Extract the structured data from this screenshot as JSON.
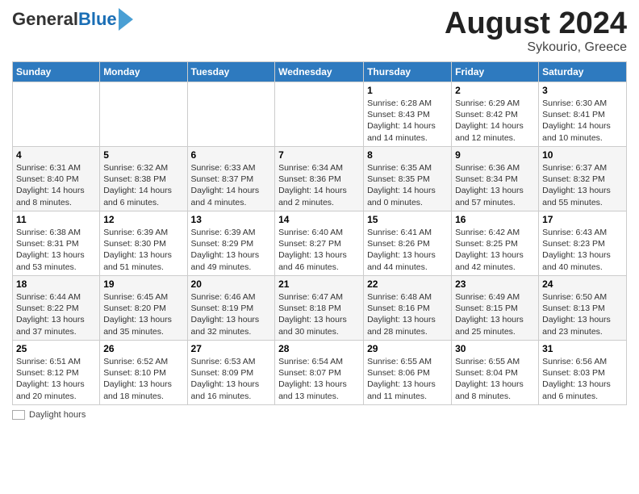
{
  "header": {
    "logo_general": "General",
    "logo_blue": "Blue",
    "month_title": "August 2024",
    "subtitle": "Sykourio, Greece"
  },
  "days_of_week": [
    "Sunday",
    "Monday",
    "Tuesday",
    "Wednesday",
    "Thursday",
    "Friday",
    "Saturday"
  ],
  "legend_label": "Daylight hours",
  "weeks": [
    [
      {
        "day": "",
        "info": ""
      },
      {
        "day": "",
        "info": ""
      },
      {
        "day": "",
        "info": ""
      },
      {
        "day": "",
        "info": ""
      },
      {
        "day": "1",
        "info": "Sunrise: 6:28 AM\nSunset: 8:43 PM\nDaylight: 14 hours and 14 minutes."
      },
      {
        "day": "2",
        "info": "Sunrise: 6:29 AM\nSunset: 8:42 PM\nDaylight: 14 hours and 12 minutes."
      },
      {
        "day": "3",
        "info": "Sunrise: 6:30 AM\nSunset: 8:41 PM\nDaylight: 14 hours and 10 minutes."
      }
    ],
    [
      {
        "day": "4",
        "info": "Sunrise: 6:31 AM\nSunset: 8:40 PM\nDaylight: 14 hours and 8 minutes."
      },
      {
        "day": "5",
        "info": "Sunrise: 6:32 AM\nSunset: 8:38 PM\nDaylight: 14 hours and 6 minutes."
      },
      {
        "day": "6",
        "info": "Sunrise: 6:33 AM\nSunset: 8:37 PM\nDaylight: 14 hours and 4 minutes."
      },
      {
        "day": "7",
        "info": "Sunrise: 6:34 AM\nSunset: 8:36 PM\nDaylight: 14 hours and 2 minutes."
      },
      {
        "day": "8",
        "info": "Sunrise: 6:35 AM\nSunset: 8:35 PM\nDaylight: 14 hours and 0 minutes."
      },
      {
        "day": "9",
        "info": "Sunrise: 6:36 AM\nSunset: 8:34 PM\nDaylight: 13 hours and 57 minutes."
      },
      {
        "day": "10",
        "info": "Sunrise: 6:37 AM\nSunset: 8:32 PM\nDaylight: 13 hours and 55 minutes."
      }
    ],
    [
      {
        "day": "11",
        "info": "Sunrise: 6:38 AM\nSunset: 8:31 PM\nDaylight: 13 hours and 53 minutes."
      },
      {
        "day": "12",
        "info": "Sunrise: 6:39 AM\nSunset: 8:30 PM\nDaylight: 13 hours and 51 minutes."
      },
      {
        "day": "13",
        "info": "Sunrise: 6:39 AM\nSunset: 8:29 PM\nDaylight: 13 hours and 49 minutes."
      },
      {
        "day": "14",
        "info": "Sunrise: 6:40 AM\nSunset: 8:27 PM\nDaylight: 13 hours and 46 minutes."
      },
      {
        "day": "15",
        "info": "Sunrise: 6:41 AM\nSunset: 8:26 PM\nDaylight: 13 hours and 44 minutes."
      },
      {
        "day": "16",
        "info": "Sunrise: 6:42 AM\nSunset: 8:25 PM\nDaylight: 13 hours and 42 minutes."
      },
      {
        "day": "17",
        "info": "Sunrise: 6:43 AM\nSunset: 8:23 PM\nDaylight: 13 hours and 40 minutes."
      }
    ],
    [
      {
        "day": "18",
        "info": "Sunrise: 6:44 AM\nSunset: 8:22 PM\nDaylight: 13 hours and 37 minutes."
      },
      {
        "day": "19",
        "info": "Sunrise: 6:45 AM\nSunset: 8:20 PM\nDaylight: 13 hours and 35 minutes."
      },
      {
        "day": "20",
        "info": "Sunrise: 6:46 AM\nSunset: 8:19 PM\nDaylight: 13 hours and 32 minutes."
      },
      {
        "day": "21",
        "info": "Sunrise: 6:47 AM\nSunset: 8:18 PM\nDaylight: 13 hours and 30 minutes."
      },
      {
        "day": "22",
        "info": "Sunrise: 6:48 AM\nSunset: 8:16 PM\nDaylight: 13 hours and 28 minutes."
      },
      {
        "day": "23",
        "info": "Sunrise: 6:49 AM\nSunset: 8:15 PM\nDaylight: 13 hours and 25 minutes."
      },
      {
        "day": "24",
        "info": "Sunrise: 6:50 AM\nSunset: 8:13 PM\nDaylight: 13 hours and 23 minutes."
      }
    ],
    [
      {
        "day": "25",
        "info": "Sunrise: 6:51 AM\nSunset: 8:12 PM\nDaylight: 13 hours and 20 minutes."
      },
      {
        "day": "26",
        "info": "Sunrise: 6:52 AM\nSunset: 8:10 PM\nDaylight: 13 hours and 18 minutes."
      },
      {
        "day": "27",
        "info": "Sunrise: 6:53 AM\nSunset: 8:09 PM\nDaylight: 13 hours and 16 minutes."
      },
      {
        "day": "28",
        "info": "Sunrise: 6:54 AM\nSunset: 8:07 PM\nDaylight: 13 hours and 13 minutes."
      },
      {
        "day": "29",
        "info": "Sunrise: 6:55 AM\nSunset: 8:06 PM\nDaylight: 13 hours and 11 minutes."
      },
      {
        "day": "30",
        "info": "Sunrise: 6:55 AM\nSunset: 8:04 PM\nDaylight: 13 hours and 8 minutes."
      },
      {
        "day": "31",
        "info": "Sunrise: 6:56 AM\nSunset: 8:03 PM\nDaylight: 13 hours and 6 minutes."
      }
    ]
  ]
}
